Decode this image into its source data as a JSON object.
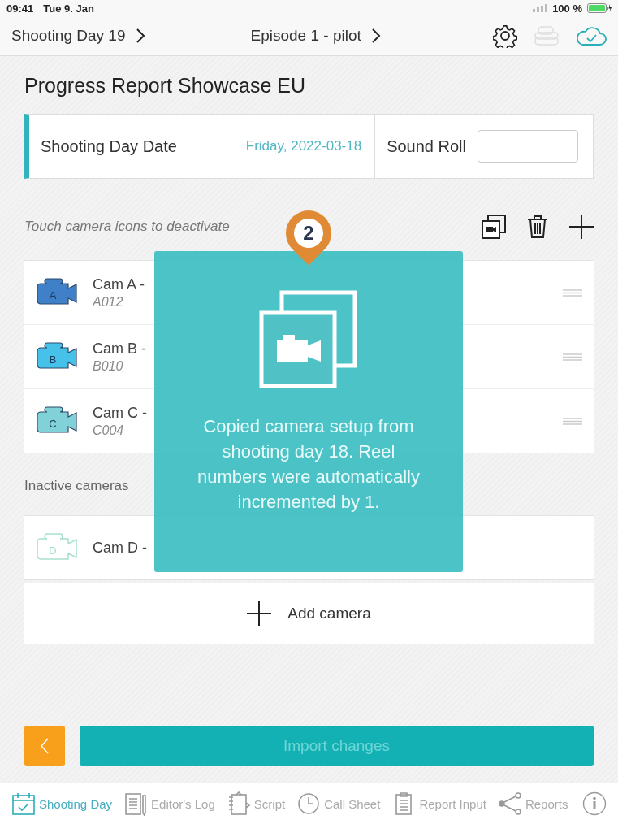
{
  "status_bar": {
    "time": "09:41",
    "date": "Tue 9. Jan",
    "battery": "100 %"
  },
  "nav": {
    "day": "Shooting Day 19",
    "episode": "Episode 1 - pilot"
  },
  "title": "Progress Report Showcase EU",
  "date_card": {
    "label": "Shooting Day Date",
    "value": "Friday, 2022-03-18",
    "sound_roll_label": "Sound Roll"
  },
  "active_hint": "Touch camera icons to deactivate",
  "cameras": [
    {
      "letter": "A",
      "name": "Cam A -",
      "reel": "A012",
      "color": "#3f80c8"
    },
    {
      "letter": "B",
      "name": "Cam B -",
      "reel": "B010",
      "color": "#46c2ea"
    },
    {
      "letter": "C",
      "name": "Cam C -",
      "reel": "C004",
      "color": "#80d2d8"
    }
  ],
  "inactive_label": "Inactive cameras",
  "inactive_cameras": [
    {
      "letter": "D",
      "name": "Cam D -",
      "color": "#a8e0cc"
    }
  ],
  "add_camera": "Add camera",
  "toast": {
    "badge": "2",
    "message": "Copied camera setup from shooting day 18. Reel numbers were automatically incremented by 1."
  },
  "import_button": "Import changes",
  "tabs": [
    {
      "label": "Shooting Day",
      "selected": true
    },
    {
      "label": "Editor's Log",
      "selected": false
    },
    {
      "label": "Script",
      "selected": false
    },
    {
      "label": "Call Sheet",
      "selected": false
    },
    {
      "label": "Report Input",
      "selected": false
    },
    {
      "label": "Reports",
      "selected": false
    }
  ]
}
